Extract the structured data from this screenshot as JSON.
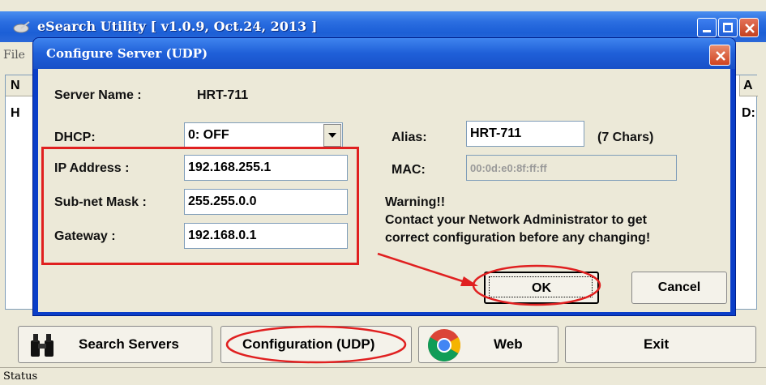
{
  "main_window": {
    "title": "eSearch Utility [ v1.0.9, Oct.24, 2013 ]",
    "menu": {
      "file_fragment": "File"
    },
    "list": {
      "left_header": "N",
      "left_cell": "H",
      "right_header": "A",
      "right_cell": "D:"
    },
    "buttons": {
      "search": "Search Servers",
      "config": "Configuration (UDP)",
      "web": "Web",
      "exit": "Exit"
    },
    "status": "Status"
  },
  "dialog": {
    "title": "Configure Server (UDP)",
    "server_name_label": "Server Name :",
    "server_name_value": "HRT-711",
    "dhcp_label": "DHCP:",
    "dhcp_value": "0: OFF",
    "ip_label": "IP Address :",
    "ip_value": "192.168.255.1",
    "mask_label": "Sub-net Mask :",
    "mask_value": "255.255.0.0",
    "gateway_label": "Gateway :",
    "gateway_value": "192.168.0.1",
    "alias_label": "Alias:",
    "alias_value": "HRT-711",
    "alias_hint": "(7 Chars)",
    "mac_label": "MAC:",
    "mac_value": "00:0d:e0:8f:ff:ff",
    "warning_title": "Warning!!",
    "warning_line1": "Contact your Network Administrator to get",
    "warning_line2": "correct  configuration before any changing!",
    "ok_label": "OK",
    "cancel_label": "Cancel"
  },
  "colors": {
    "titlebar_blue": "#1c5fd6",
    "window_bg": "#ece9d8",
    "annotation_red": "#e02020"
  }
}
